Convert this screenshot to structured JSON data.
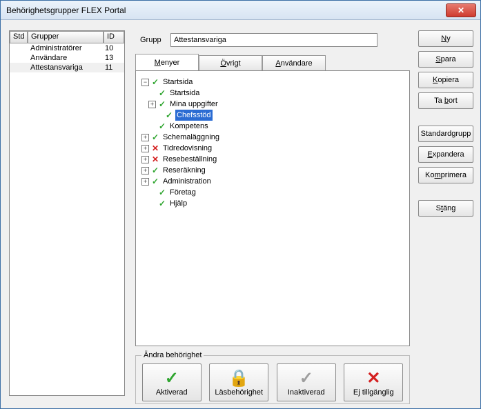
{
  "title": "Behörighetsgrupper FLEX Portal",
  "columns": {
    "std": "Std",
    "grupper": "Grupper",
    "id": "ID"
  },
  "rows": [
    {
      "name": "Administratörer",
      "id": "10",
      "selected": false
    },
    {
      "name": "Användare",
      "id": "13",
      "selected": false
    },
    {
      "name": "Attestansvariga",
      "id": "11",
      "selected": true
    }
  ],
  "grupp_label": "Grupp",
  "grupp_value": "Attestansvariga",
  "tabs": [
    {
      "label": "Menyer",
      "key": "M",
      "active": true
    },
    {
      "label": "Övrigt",
      "key": "Ö",
      "active": false
    },
    {
      "label": "Användare",
      "key": "A",
      "active": false
    }
  ],
  "tree": [
    {
      "indent": 0,
      "exp": "minus",
      "status": "check",
      "label": "Startsida"
    },
    {
      "indent": 1,
      "exp": "none",
      "status": "check",
      "label": "Startsida"
    },
    {
      "indent": 1,
      "exp": "plus",
      "status": "check",
      "label": "Mina uppgifter"
    },
    {
      "indent": 2,
      "exp": "none",
      "status": "check",
      "label": "Chefsstöd",
      "selected": true
    },
    {
      "indent": 1,
      "exp": "none",
      "status": "check",
      "label": "Kompetens"
    },
    {
      "indent": 0,
      "exp": "plus",
      "status": "check",
      "label": "Schemaläggning"
    },
    {
      "indent": 0,
      "exp": "plus",
      "status": "cross",
      "label": "Tidredovisning"
    },
    {
      "indent": 0,
      "exp": "plus",
      "status": "cross",
      "label": "Resebeställning"
    },
    {
      "indent": 0,
      "exp": "plus",
      "status": "check",
      "label": "Reseräkning"
    },
    {
      "indent": 0,
      "exp": "plus",
      "status": "check",
      "label": "Administration"
    },
    {
      "indent": 1,
      "exp": "none",
      "status": "check",
      "label": "Företag"
    },
    {
      "indent": 1,
      "exp": "none",
      "status": "check",
      "label": "Hjälp"
    }
  ],
  "change_legend": "Ändra behörighet",
  "change_buttons": {
    "aktiverad": "Aktiverad",
    "las": "Läsbehörighet",
    "inaktiverad": "Inaktiverad",
    "ej": "Ej tillgänglig"
  },
  "side": {
    "ny": "Ny",
    "spara": "Spara",
    "kopiera": "Kopiera",
    "tabort": "Ta bort",
    "standard": "Standardgrupp",
    "expandera": "Expandera",
    "komprimera": "Komprimera",
    "stang": "Stäng"
  }
}
